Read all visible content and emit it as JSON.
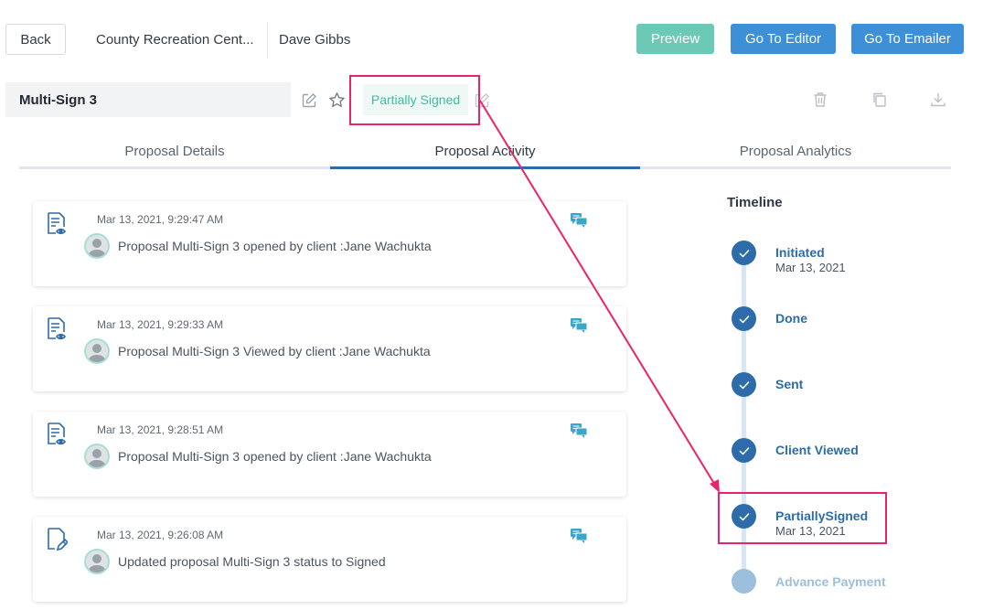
{
  "header": {
    "back_label": "Back",
    "client_name": "County Recreation Cent...",
    "user_name": "Dave Gibbs",
    "preview_label": "Preview",
    "editor_label": "Go To Editor",
    "emailer_label": "Go To Emailer"
  },
  "proposal": {
    "title": "Multi-Sign 3",
    "status": "Partially Signed"
  },
  "tabs": [
    {
      "label": "Proposal Details"
    },
    {
      "label": "Proposal Activity"
    },
    {
      "label": "Proposal Analytics"
    }
  ],
  "activities": [
    {
      "timestamp": "Mar 13, 2021, 9:29:47 AM",
      "message": "Proposal Multi-Sign 3 opened by client :Jane Wachukta",
      "icon": "document-view-icon"
    },
    {
      "timestamp": "Mar 13, 2021, 9:29:33 AM",
      "message": "Proposal Multi-Sign 3 Viewed by client :Jane Wachukta",
      "icon": "document-view-icon"
    },
    {
      "timestamp": "Mar 13, 2021, 9:28:51 AM",
      "message": "Proposal Multi-Sign 3 opened by client :Jane Wachukta",
      "icon": "document-view-icon"
    },
    {
      "timestamp": "Mar 13, 2021, 9:26:08 AM",
      "message": "Updated proposal Multi-Sign 3 status to Signed",
      "icon": "document-edit-icon"
    }
  ],
  "timeline": {
    "title": "Timeline",
    "steps": [
      {
        "label": "Initiated",
        "date": "Mar 13, 2021",
        "done": true
      },
      {
        "label": "Done",
        "date": "",
        "done": true
      },
      {
        "label": "Sent",
        "date": "",
        "done": true
      },
      {
        "label": "Client Viewed",
        "date": "",
        "done": true
      },
      {
        "label": "PartiallySigned",
        "date": "Mar 13, 2021",
        "done": true
      },
      {
        "label": "Advance Payment",
        "date": "",
        "done": false
      }
    ]
  },
  "colors": {
    "primary": "#3d8fd6",
    "preview": "#6bc9b6",
    "status_text": "#3bbf9e",
    "timeline_done": "#2d6ca8",
    "timeline_pending": "#9cbfdc",
    "annotation": "#e8246e"
  }
}
